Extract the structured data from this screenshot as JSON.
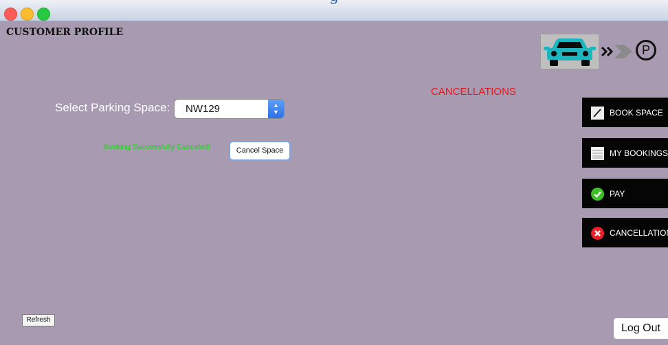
{
  "window": {
    "title_text": "g"
  },
  "header": {
    "page_title": "CUSTOMER PROFILE",
    "logo_letter": "P"
  },
  "main": {
    "section_title": "CANCELLATIONS",
    "select_label": "Select Parking Space:",
    "select_value": "NW129",
    "status_message": "Booking Successfully Canceled!",
    "cancel_button": "Cancel Space",
    "refresh_button": "Refresh",
    "logout_button": "Log Out"
  },
  "sidebar": {
    "items": [
      {
        "label": "BOOK SPACE",
        "icon": "pencil-icon"
      },
      {
        "label": "MY BOOKINGS",
        "icon": "list-icon"
      },
      {
        "label": "PAY",
        "icon": "check-circle-icon"
      },
      {
        "label": "CANCELLATIONS",
        "icon": "x-circle-icon"
      }
    ]
  },
  "colors": {
    "background": "#a89ab0",
    "section_title": "#e8171e",
    "status_message": "#23d023",
    "sidebar_button": "#050505",
    "logo_car": "#1fb5bf"
  }
}
